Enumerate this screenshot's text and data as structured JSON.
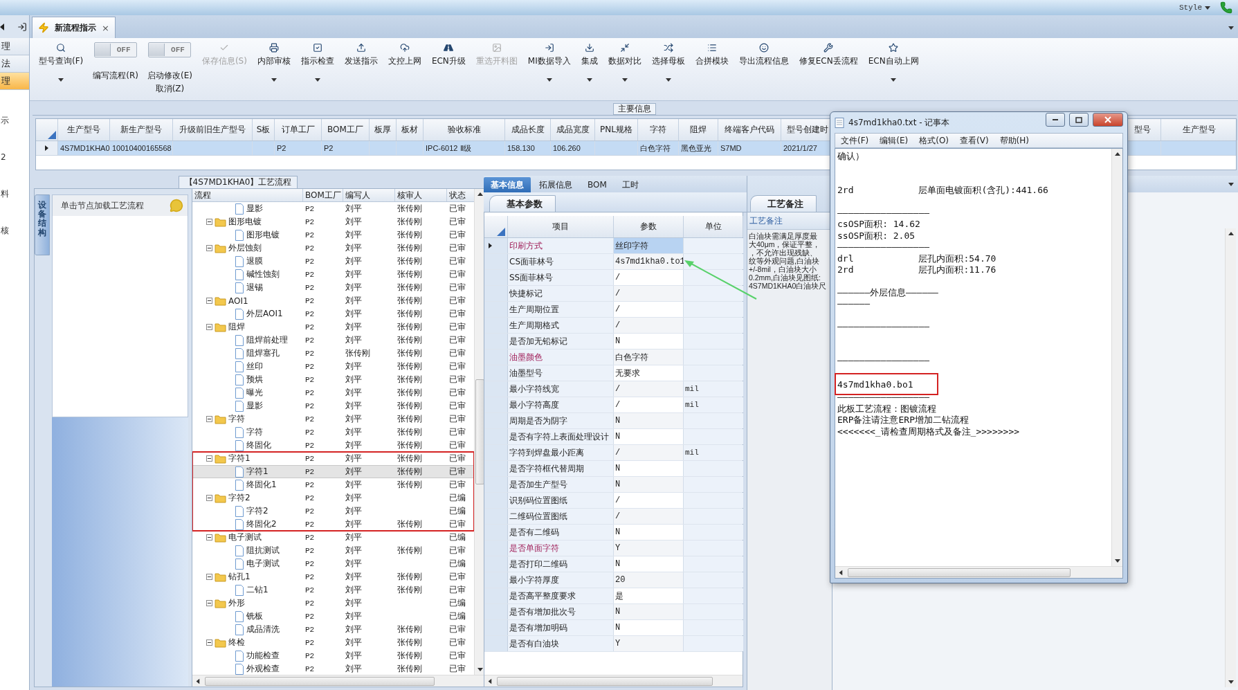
{
  "title_bar": {
    "style_menu": "Style"
  },
  "side_nav": {
    "items": [
      {
        "label": "理",
        "selected": false
      },
      {
        "label": "法",
        "selected": false
      },
      {
        "label": "理",
        "selected": true
      }
    ],
    "links": [
      "示",
      "2",
      "料",
      "核"
    ]
  },
  "document_tab": {
    "title": "新流程指示",
    "close": "×"
  },
  "toolbar": {
    "items": [
      {
        "kind": "button",
        "label": "型号查询(F)",
        "dropdown": true,
        "disabled": false
      },
      {
        "kind": "toggle",
        "label": "编写流程(R)",
        "state_text": "OFF",
        "on": false
      },
      {
        "kind": "toggle",
        "label": "启动修改(E)",
        "sublabel": "取消(Z)",
        "state_text": "OFF",
        "on": false
      },
      {
        "kind": "button",
        "label": "保存信息(S)",
        "dropdown": false,
        "disabled": true
      },
      {
        "kind": "button",
        "label": "内部审核",
        "dropdown": true,
        "disabled": false
      },
      {
        "kind": "button",
        "label": "指示检查",
        "dropdown": true,
        "disabled": false
      },
      {
        "kind": "button",
        "label": "发送指示",
        "dropdown": false,
        "disabled": false
      },
      {
        "kind": "button",
        "label": "文控上网",
        "dropdown": false,
        "disabled": false
      },
      {
        "kind": "button",
        "label": "ECN升级",
        "dropdown": false,
        "disabled": false
      },
      {
        "kind": "button",
        "label": "重选开料图",
        "dropdown": false,
        "disabled": true
      },
      {
        "kind": "button",
        "label": "MI数据导入",
        "dropdown": true,
        "disabled": false
      },
      {
        "kind": "button",
        "label": "集成",
        "dropdown": true,
        "disabled": false
      },
      {
        "kind": "button",
        "label": "数据对比",
        "dropdown": true,
        "disabled": false
      },
      {
        "kind": "button",
        "label": "选择母板",
        "dropdown": true,
        "disabled": false
      },
      {
        "kind": "button",
        "label": "合拼模块",
        "dropdown": false,
        "disabled": false
      },
      {
        "kind": "button",
        "label": "导出流程信息",
        "dropdown": false,
        "disabled": false
      },
      {
        "kind": "button",
        "label": "修复ECN丢流程",
        "dropdown": false,
        "disabled": false
      },
      {
        "kind": "button",
        "label": "ECN自动上网",
        "dropdown": true,
        "disabled": false
      }
    ]
  },
  "main_info": {
    "title": "主要信息",
    "row_selected": true,
    "columns": [
      {
        "label": "生产型号",
        "value": "4S7MD1KHA0"
      },
      {
        "label": "新生产型号",
        "value": "10010400165568"
      },
      {
        "label": "升级前旧生产型号"
      },
      {
        "label": "S板"
      },
      {
        "label": "订单工厂",
        "value": "P2"
      },
      {
        "label": "BOM工厂",
        "value": "P2"
      },
      {
        "label": "板厚"
      },
      {
        "label": "板材"
      },
      {
        "label": "验收标准",
        "value": "IPC-6012 Ⅱ级"
      },
      {
        "label": "成品长度",
        "value": "158.130"
      },
      {
        "label": "成品宽度",
        "value": "106.260"
      },
      {
        "label": "PNL规格"
      },
      {
        "label": "字符",
        "value": "白色字符"
      },
      {
        "label": "阻焊",
        "value": "黑色亚光"
      },
      {
        "label": "终端客户代码",
        "value": "S7MD"
      },
      {
        "label": "型号创建时",
        "value": "2021/1/27"
      },
      {
        "label": "型号"
      },
      {
        "label": "生产型号"
      }
    ]
  },
  "flow": {
    "title": "【4S7MD1KHA0】工艺流程",
    "side_tab": "设备结构",
    "hint": "单击节点加载工艺流程",
    "columns": [
      "流程",
      "BOM工厂",
      "编写人",
      "核审人",
      "状态"
    ],
    "nodes": [
      {
        "children": [
          {
            "label": "显影",
            "factory": "P2",
            "author": "刘平",
            "reviewer": "张传刚",
            "status": "已审",
            "selected": false
          }
        ]
      },
      {
        "label": "图形电镀",
        "factory": "P2",
        "author": "刘平",
        "reviewer": "张传刚",
        "status": "已审",
        "selected": false,
        "expanded": true,
        "annotated": false,
        "children": [
          {
            "label": "图形电镀",
            "factory": "P2",
            "author": "刘平",
            "reviewer": "张传刚",
            "status": "已审",
            "selected": false
          }
        ]
      },
      {
        "label": "外层蚀刻",
        "factory": "P2",
        "author": "刘平",
        "reviewer": "张传刚",
        "status": "已审",
        "selected": false,
        "expanded": true,
        "annotated": false,
        "children": [
          {
            "label": "退膜",
            "factory": "P2",
            "author": "刘平",
            "reviewer": "张传刚",
            "status": "已审",
            "selected": false
          },
          {
            "label": "碱性蚀刻",
            "factory": "P2",
            "author": "刘平",
            "reviewer": "张传刚",
            "status": "已审",
            "selected": false
          },
          {
            "label": "退锡",
            "factory": "P2",
            "author": "刘平",
            "reviewer": "张传刚",
            "status": "已审",
            "selected": false
          }
        ]
      },
      {
        "label": "AOI1",
        "factory": "P2",
        "author": "刘平",
        "reviewer": "张传刚",
        "status": "已审",
        "selected": false,
        "expanded": true,
        "annotated": false,
        "children": [
          {
            "label": "外层AOI1",
            "factory": "P2",
            "author": "刘平",
            "reviewer": "张传刚",
            "status": "已审",
            "selected": false
          }
        ]
      },
      {
        "label": "阻焊",
        "factory": "P2",
        "author": "刘平",
        "reviewer": "张传刚",
        "status": "已审",
        "selected": false,
        "expanded": true,
        "annotated": false,
        "children": [
          {
            "label": "阻焊前处理",
            "factory": "P2",
            "author": "刘平",
            "reviewer": "张传刚",
            "status": "已审",
            "selected": false
          },
          {
            "label": "阻焊塞孔",
            "factory": "P2",
            "author": "张传刚",
            "reviewer": "张传刚",
            "status": "已审",
            "selected": false
          },
          {
            "label": "丝印",
            "factory": "P2",
            "author": "刘平",
            "reviewer": "张传刚",
            "status": "已审",
            "selected": false
          },
          {
            "label": "预烘",
            "factory": "P2",
            "author": "刘平",
            "reviewer": "张传刚",
            "status": "已审",
            "selected": false
          },
          {
            "label": "曝光",
            "factory": "P2",
            "author": "刘平",
            "reviewer": "张传刚",
            "status": "已审",
            "selected": false
          },
          {
            "label": "显影",
            "factory": "P2",
            "author": "刘平",
            "reviewer": "张传刚",
            "status": "已审",
            "selected": false
          }
        ]
      },
      {
        "label": "字符",
        "factory": "P2",
        "author": "刘平",
        "reviewer": "张传刚",
        "status": "已审",
        "selected": false,
        "expanded": true,
        "annotated": false,
        "children": [
          {
            "label": "字符",
            "factory": "P2",
            "author": "刘平",
            "reviewer": "张传刚",
            "status": "已审",
            "selected": false
          },
          {
            "label": "终固化",
            "factory": "P2",
            "author": "刘平",
            "reviewer": "张传刚",
            "status": "已审",
            "selected": false
          }
        ]
      },
      {
        "label": "字符1",
        "factory": "P2",
        "author": "刘平",
        "reviewer": "张传刚",
        "status": "已审",
        "selected": false,
        "expanded": true,
        "annotated": true,
        "children": [
          {
            "label": "字符1",
            "factory": "P2",
            "author": "刘平",
            "reviewer": "张传刚",
            "status": "已审",
            "selected": true
          },
          {
            "label": "终固化1",
            "factory": "P2",
            "author": "刘平",
            "reviewer": "张传刚",
            "status": "已审",
            "selected": false
          }
        ]
      },
      {
        "label": "字符2",
        "factory": "P2",
        "author": "刘平",
        "status": "已编",
        "selected": false,
        "expanded": true,
        "annotated": true,
        "children": [
          {
            "label": "字符2",
            "factory": "P2",
            "author": "刘平",
            "status": "已编",
            "selected": false
          },
          {
            "label": "终固化2",
            "factory": "P2",
            "author": "刘平",
            "reviewer": "张传刚",
            "status": "已审",
            "selected": false
          }
        ]
      },
      {
        "label": "电子测试",
        "factory": "P2",
        "author": "刘平",
        "status": "已编",
        "selected": false,
        "expanded": true,
        "annotated": false,
        "children": [
          {
            "label": "阻抗测试",
            "factory": "P2",
            "author": "刘平",
            "reviewer": "张传刚",
            "status": "已审",
            "selected": false
          },
          {
            "label": "电子测试",
            "factory": "P2",
            "author": "刘平",
            "status": "已编",
            "selected": false
          }
        ]
      },
      {
        "label": "钻孔1",
        "factory": "P2",
        "author": "刘平",
        "reviewer": "张传刚",
        "status": "已审",
        "selected": false,
        "expanded": true,
        "annotated": false,
        "children": [
          {
            "label": "二钻1",
            "factory": "P2",
            "author": "刘平",
            "reviewer": "张传刚",
            "status": "已审",
            "selected": false
          }
        ]
      },
      {
        "label": "外形",
        "factory": "P2",
        "author": "刘平",
        "status": "已编",
        "selected": false,
        "expanded": true,
        "annotated": false,
        "children": [
          {
            "label": "铣板",
            "factory": "P2",
            "author": "刘平",
            "status": "已编",
            "selected": false
          },
          {
            "label": "成品清洗",
            "factory": "P2",
            "author": "刘平",
            "reviewer": "张传刚",
            "status": "已审",
            "selected": false
          }
        ]
      },
      {
        "label": "终检",
        "factory": "P2",
        "author": "刘平",
        "reviewer": "张传刚",
        "status": "已审",
        "selected": false,
        "expanded": true,
        "annotated": false,
        "children": [
          {
            "label": "功能检查",
            "factory": "P2",
            "author": "刘平",
            "reviewer": "张传刚",
            "status": "已审",
            "selected": false
          },
          {
            "label": "外观检查",
            "factory": "P2",
            "author": "刘平",
            "reviewer": "张传刚",
            "status": "已审",
            "selected": false
          }
        ]
      }
    ]
  },
  "properties": {
    "tabs": [
      {
        "label": "基本信息",
        "selected": true
      },
      {
        "label": "拓展信息",
        "selected": false
      },
      {
        "label": "BOM",
        "selected": false
      },
      {
        "label": "工时",
        "selected": false
      }
    ],
    "subtab": "基本参数",
    "columns": [
      "项目",
      "参数",
      "单位"
    ],
    "rows": [
      {
        "name": "印刷方式",
        "value": "丝印字符",
        "emphasized": true,
        "selected": true
      },
      {
        "name": "CS面菲林号",
        "value": "4s7md1kha0.to1",
        "emphasized": false,
        "selected": false
      },
      {
        "name": "SS面菲林号",
        "value": "/",
        "emphasized": false,
        "selected": false
      },
      {
        "name": "快捷标记",
        "value": "/",
        "emphasized": false,
        "selected": false
      },
      {
        "name": "生产周期位置",
        "value": "/",
        "emphasized": false,
        "selected": false
      },
      {
        "name": "生产周期格式",
        "value": "/",
        "emphasized": false,
        "selected": false
      },
      {
        "name": "是否加无铅标记",
        "value": "N",
        "emphasized": false,
        "selected": false
      },
      {
        "name": "油墨颜色",
        "value": "白色字符",
        "emphasized": true,
        "selected": false
      },
      {
        "name": "油墨型号",
        "value": "无要求",
        "emphasized": false,
        "selected": false
      },
      {
        "name": "最小字符线宽",
        "value": "/",
        "unit": "mil",
        "emphasized": false,
        "selected": false
      },
      {
        "name": "最小字符高度",
        "value": "/",
        "unit": "mil",
        "emphasized": false,
        "selected": false
      },
      {
        "name": "周期是否为阴字",
        "value": "N",
        "emphasized": false,
        "selected": false
      },
      {
        "name": "是否有字符上表面处理设计",
        "value": "N",
        "emphasized": false,
        "selected": false
      },
      {
        "name": "字符到焊盘最小距离",
        "value": "/",
        "unit": "mil",
        "emphasized": false,
        "selected": false
      },
      {
        "name": "是否字符框代替周期",
        "value": "N",
        "emphasized": false,
        "selected": false
      },
      {
        "name": "是否加生产型号",
        "value": "N",
        "emphasized": false,
        "selected": false
      },
      {
        "name": "识别码位置图纸",
        "value": "/",
        "emphasized": false,
        "selected": false
      },
      {
        "name": "二维码位置图纸",
        "value": "/",
        "emphasized": false,
        "selected": false
      },
      {
        "name": "是否有二维码",
        "value": "N",
        "emphasized": false,
        "selected": false
      },
      {
        "name": "是否单面字符",
        "value": "Y",
        "emphasized": true,
        "selected": false
      },
      {
        "name": "是否打印二维码",
        "value": "N",
        "emphasized": false,
        "selected": false
      },
      {
        "name": "最小字符厚度",
        "value": "20",
        "emphasized": false,
        "selected": false
      },
      {
        "name": "是否高平整度要求",
        "value": "是",
        "emphasized": false,
        "selected": false
      },
      {
        "name": "是否有增加批次号",
        "value": "N",
        "emphasized": false,
        "selected": false
      },
      {
        "name": "是否有增加明码",
        "value": "N",
        "emphasized": false,
        "selected": false
      },
      {
        "name": "是否有白油块",
        "value": "Y",
        "emphasized": false,
        "selected": false
      }
    ]
  },
  "remarks": {
    "tab": "工艺备注",
    "header": "工艺备注",
    "lines": [
      "白油块需满足厚度最",
      "大40μm，保证平整，",
      "，不允许出现残缺、",
      "纹等外观问题,白油块",
      "+/-8mil，白油块大小",
      "0.2mm,白油块见图纸:",
      "4S7MD1KHA0白油块尺"
    ]
  },
  "notepad": {
    "title": "4s7md1kha0.txt - 记事本",
    "menu": [
      "文件(F)",
      "编辑(E)",
      "格式(O)",
      "查看(V)",
      "帮助(H)"
    ],
    "content": [
      {
        "text": "确认）\n\n\n2rd            层单面电镀面积(含孔):441.66\n\n—————————————————\ncsOSP面积: 14.62\nssOSP面积: 2.05\n—————————————————\ndrl            层孔内面积:54.70\n2rd            层孔内面积:11.76\n\n——————外层信息——————\n——————\n\n—————————————————\n\n\n—————————————————\n",
        "boxed": false
      },
      {
        "text": "4s7md1kha0.bo1",
        "boxed": true
      },
      {
        "text": "—————————————————\n此板工艺流程：图镀流程\nERP备注请注意ERP增加二钻流程\n<<<<<<<_请检查周期格式及备注_>>>>>>>>",
        "boxed": false
      }
    ]
  }
}
